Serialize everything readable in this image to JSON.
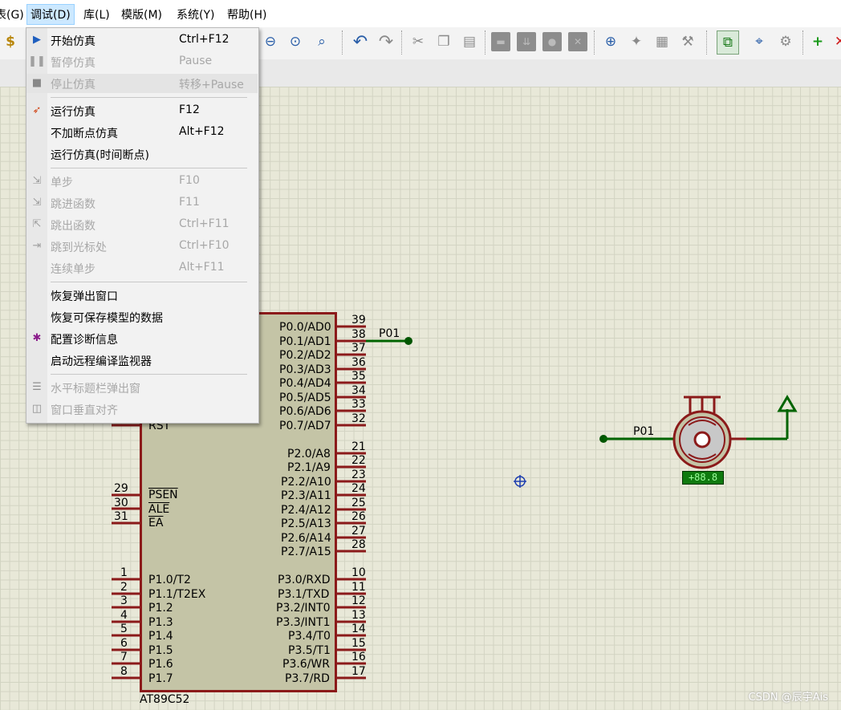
{
  "menubar": {
    "items": [
      "表(G)",
      "调试(D)",
      "库(L)",
      "模版(M)",
      "系统(Y)",
      "帮助(H)"
    ]
  },
  "debug_menu": {
    "items": [
      {
        "label": "开始仿真",
        "shortcut": "Ctrl+F12",
        "icon": "play-icon",
        "enabled": true
      },
      {
        "label": "暂停仿真",
        "shortcut": "Pause",
        "icon": "pause-icon",
        "enabled": false
      },
      {
        "label": "停止仿真",
        "shortcut": "转移+Pause",
        "icon": "stop-icon",
        "enabled": false
      },
      {
        "label": "运行仿真",
        "shortcut": "F12",
        "icon": "run-icon",
        "enabled": true
      },
      {
        "label": "不加断点仿真",
        "shortcut": "Alt+F12",
        "icon": "",
        "enabled": true
      },
      {
        "label": "运行仿真(时间断点)",
        "shortcut": "",
        "icon": "",
        "enabled": true
      },
      {
        "label": "单步",
        "shortcut": "F10",
        "icon": "step-icon",
        "enabled": false
      },
      {
        "label": "跳进函数",
        "shortcut": "F11",
        "icon": "step-into-icon",
        "enabled": false
      },
      {
        "label": "跳出函数",
        "shortcut": "Ctrl+F11",
        "icon": "step-out-icon",
        "enabled": false
      },
      {
        "label": "跳到光标处",
        "shortcut": "Ctrl+F10",
        "icon": "run-to-cursor-icon",
        "enabled": false
      },
      {
        "label": "连续单步",
        "shortcut": "Alt+F11",
        "icon": "",
        "enabled": false
      },
      {
        "label": "恢复弹出窗口",
        "shortcut": "",
        "icon": "",
        "enabled": true
      },
      {
        "label": "恢复可保存模型的数据",
        "shortcut": "",
        "icon": "",
        "enabled": true
      },
      {
        "label": "配置诊断信息",
        "shortcut": "",
        "icon": "bug-icon",
        "enabled": true
      },
      {
        "label": "启动远程编译监视器",
        "shortcut": "",
        "icon": "",
        "enabled": true
      },
      {
        "label": "水平标题栏弹出窗",
        "shortcut": "",
        "icon": "horizontal-tile-icon",
        "enabled": false
      },
      {
        "label": "窗口垂直对齐",
        "shortcut": "",
        "icon": "vertical-tile-icon",
        "enabled": false
      }
    ]
  },
  "chip": {
    "part": "AT89C52",
    "reset_label": "RST",
    "left_pins": [
      {
        "num": "29",
        "label": "PSEN"
      },
      {
        "num": "30",
        "label": "ALE"
      },
      {
        "num": "31",
        "label": "EA"
      }
    ],
    "port1": [
      {
        "num": "1",
        "label": "P1.0/T2"
      },
      {
        "num": "2",
        "label": "P1.1/T2EX"
      },
      {
        "num": "3",
        "label": "P1.2"
      },
      {
        "num": "4",
        "label": "P1.3"
      },
      {
        "num": "5",
        "label": "P1.4"
      },
      {
        "num": "6",
        "label": "P1.5"
      },
      {
        "num": "7",
        "label": "P1.6"
      },
      {
        "num": "8",
        "label": "P1.7"
      }
    ],
    "port0": [
      {
        "num": "39",
        "label": "P0.0/AD0"
      },
      {
        "num": "38",
        "label": "P0.1/AD1"
      },
      {
        "num": "37",
        "label": "P0.2/AD2"
      },
      {
        "num": "36",
        "label": "P0.3/AD3"
      },
      {
        "num": "35",
        "label": "P0.4/AD4"
      },
      {
        "num": "34",
        "label": "P0.5/AD5"
      },
      {
        "num": "33",
        "label": "P0.6/AD6"
      },
      {
        "num": "32",
        "label": "P0.7/AD7"
      }
    ],
    "port2": [
      {
        "num": "21",
        "label": "P2.0/A8"
      },
      {
        "num": "22",
        "label": "P2.1/A9"
      },
      {
        "num": "23",
        "label": "P2.2/A10"
      },
      {
        "num": "24",
        "label": "P2.3/A11"
      },
      {
        "num": "25",
        "label": "P2.4/A12"
      },
      {
        "num": "26",
        "label": "P2.5/A13"
      },
      {
        "num": "27",
        "label": "P2.6/A14"
      },
      {
        "num": "28",
        "label": "P2.7/A15"
      }
    ],
    "port3": [
      {
        "num": "10",
        "label": "P3.0/RXD"
      },
      {
        "num": "11",
        "label": "P3.1/TXD"
      },
      {
        "num": "12",
        "label": "P3.2/INT0"
      },
      {
        "num": "13",
        "label": "P3.3/INT1"
      },
      {
        "num": "14",
        "label": "P3.4/T0"
      },
      {
        "num": "15",
        "label": "P3.5/T1"
      },
      {
        "num": "16",
        "label": "P3.6/WR"
      },
      {
        "num": "17",
        "label": "P3.7/RD"
      }
    ]
  },
  "net_label_chip": "P01",
  "net_label_motor": "P01",
  "motor_readout": "+88.8",
  "colors": {
    "wire": "#006400",
    "component": "#8b1a1a",
    "canvas": "#e8e8d8",
    "grid": "#d2d3c2"
  },
  "watermark": "CSDN @辰宇Ais"
}
